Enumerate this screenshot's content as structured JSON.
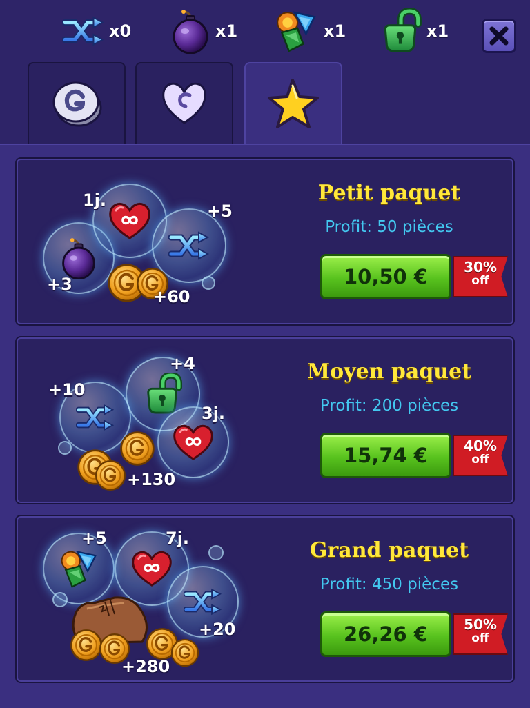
{
  "resources": [
    {
      "name": "shuffle",
      "count": "x0"
    },
    {
      "name": "bomb",
      "count": "x1"
    },
    {
      "name": "gems",
      "count": "x1"
    },
    {
      "name": "lock",
      "count": "x1"
    }
  ],
  "tabs": [
    "coins-tab",
    "heart-tab",
    "star-tab"
  ],
  "active_tab": 2,
  "packs": [
    {
      "title": "Petit paquet",
      "profit": "Profit: 50 pièces",
      "price": "10,50 €",
      "discount": "30%",
      "off": "off",
      "items": [
        "1j.",
        "+5",
        "+3",
        "+60"
      ]
    },
    {
      "title": "Moyen paquet",
      "profit": "Profit: 200 pièces",
      "price": "15,74 €",
      "discount": "40%",
      "off": "off",
      "items": [
        "+4",
        "+10",
        "3j.",
        "+130"
      ]
    },
    {
      "title": "Grand paquet",
      "profit": "Profit: 450 pièces",
      "price": "26,26 €",
      "discount": "50%",
      "off": "off",
      "items": [
        "+5",
        "7j.",
        "+20",
        "+280"
      ]
    }
  ]
}
